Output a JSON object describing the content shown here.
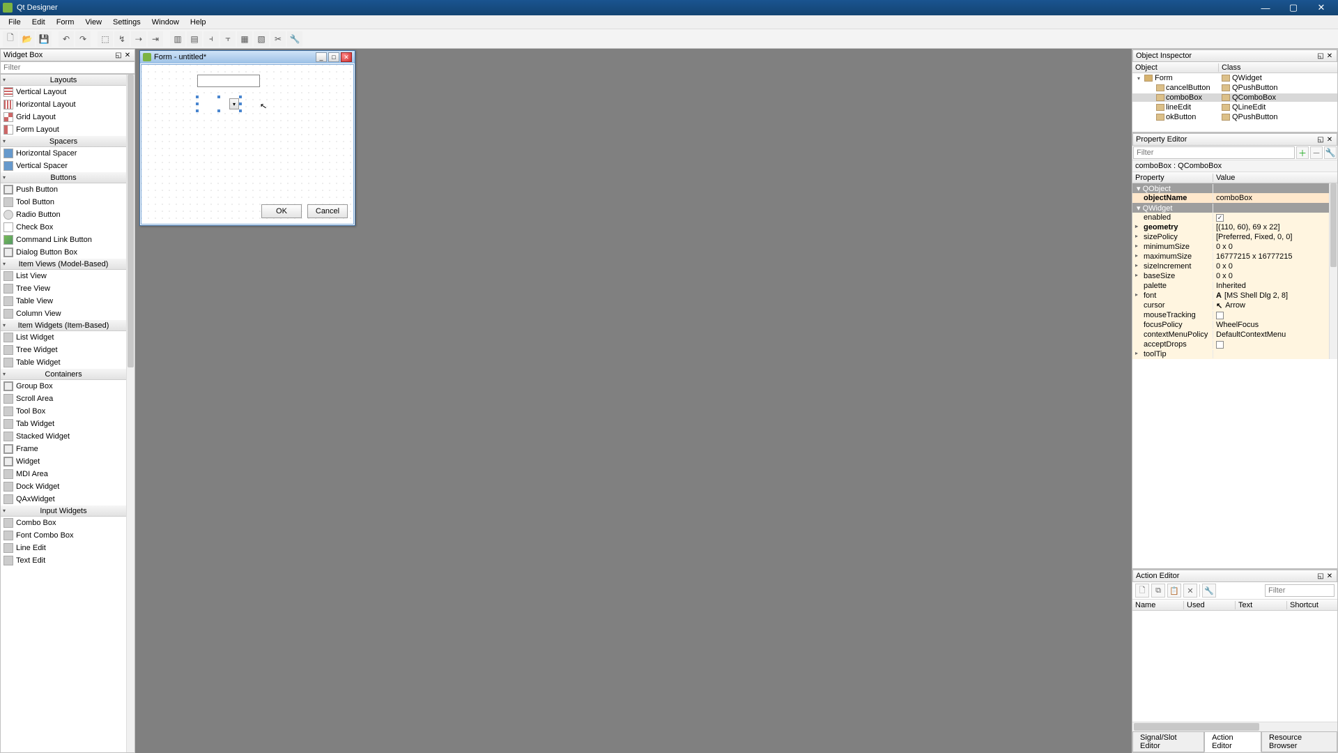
{
  "app": {
    "title": "Qt Designer"
  },
  "menu": [
    "File",
    "Edit",
    "Form",
    "View",
    "Settings",
    "Window",
    "Help"
  ],
  "widgetbox": {
    "title": "Widget Box",
    "filter_placeholder": "Filter",
    "groups": [
      {
        "name": "Layouts",
        "items": [
          {
            "cls": "vl",
            "label": "Vertical Layout"
          },
          {
            "cls": "hl",
            "label": "Horizontal Layout"
          },
          {
            "cls": "gl",
            "label": "Grid Layout"
          },
          {
            "cls": "fl",
            "label": "Form Layout"
          }
        ]
      },
      {
        "name": "Spacers",
        "items": [
          {
            "cls": "hs",
            "label": "Horizontal Spacer"
          },
          {
            "cls": "vs",
            "label": "Vertical Spacer"
          }
        ]
      },
      {
        "name": "Buttons",
        "items": [
          {
            "cls": "pb",
            "label": "Push Button"
          },
          {
            "cls": "tb",
            "label": "Tool Button"
          },
          {
            "cls": "rb",
            "label": "Radio Button"
          },
          {
            "cls": "cb",
            "label": "Check Box"
          },
          {
            "cls": "lk",
            "label": "Command Link Button"
          },
          {
            "cls": "pb",
            "label": "Dialog Button Box"
          }
        ]
      },
      {
        "name": "Item Views (Model-Based)",
        "items": [
          {
            "cls": "tb",
            "label": "List View"
          },
          {
            "cls": "tb",
            "label": "Tree View"
          },
          {
            "cls": "tb",
            "label": "Table View"
          },
          {
            "cls": "tb",
            "label": "Column View"
          }
        ]
      },
      {
        "name": "Item Widgets (Item-Based)",
        "items": [
          {
            "cls": "tb",
            "label": "List Widget"
          },
          {
            "cls": "tb",
            "label": "Tree Widget"
          },
          {
            "cls": "tb",
            "label": "Table Widget"
          }
        ]
      },
      {
        "name": "Containers",
        "items": [
          {
            "cls": "pb",
            "label": "Group Box"
          },
          {
            "cls": "tb",
            "label": "Scroll Area"
          },
          {
            "cls": "tb",
            "label": "Tool Box"
          },
          {
            "cls": "tb",
            "label": "Tab Widget"
          },
          {
            "cls": "tb",
            "label": "Stacked Widget"
          },
          {
            "cls": "pb",
            "label": "Frame"
          },
          {
            "cls": "pb",
            "label": "Widget"
          },
          {
            "cls": "tb",
            "label": "MDI Area"
          },
          {
            "cls": "tb",
            "label": "Dock Widget"
          },
          {
            "cls": "tb",
            "label": "QAxWidget"
          }
        ]
      },
      {
        "name": "Input Widgets",
        "items": [
          {
            "cls": "tb",
            "label": "Combo Box"
          },
          {
            "cls": "tb",
            "label": "Font Combo Box"
          },
          {
            "cls": "tb",
            "label": "Line Edit"
          },
          {
            "cls": "tb",
            "label": "Text Edit"
          }
        ]
      }
    ]
  },
  "form_window": {
    "title": "Form - untitled*",
    "ok": "OK",
    "cancel": "Cancel"
  },
  "object_inspector": {
    "title": "Object Inspector",
    "cols": [
      "Object",
      "Class"
    ],
    "rows": [
      {
        "indent": 0,
        "name": "Form",
        "cls": "QWidget",
        "exp": true
      },
      {
        "indent": 1,
        "name": "cancelButton",
        "cls": "QPushButton"
      },
      {
        "indent": 1,
        "name": "comboBox",
        "cls": "QComboBox",
        "sel": true
      },
      {
        "indent": 1,
        "name": "lineEdit",
        "cls": "QLineEdit"
      },
      {
        "indent": 1,
        "name": "okButton",
        "cls": "QPushButton"
      }
    ]
  },
  "property_editor": {
    "title": "Property Editor",
    "filter_placeholder": "Filter",
    "context": "comboBox : QComboBox",
    "cols": [
      "Property",
      "Value"
    ],
    "groups": [
      {
        "name": "QObject",
        "rows": [
          {
            "k": "objectName",
            "v": "comboBox",
            "cls": "obj"
          }
        ]
      },
      {
        "name": "QWidget",
        "rows": [
          {
            "k": "enabled",
            "v": "",
            "chk": true,
            "cls": "w"
          },
          {
            "k": "geometry",
            "v": "[(110, 60), 69 x 22]",
            "cls": "w",
            "exp": true
          },
          {
            "k": "sizePolicy",
            "v": "[Preferred, Fixed, 0, 0]",
            "cls": "w",
            "exp": true
          },
          {
            "k": "minimumSize",
            "v": "0 x 0",
            "cls": "w",
            "exp": true
          },
          {
            "k": "maximumSize",
            "v": "16777215 x 16777215",
            "cls": "w",
            "exp": true
          },
          {
            "k": "sizeIncrement",
            "v": "0 x 0",
            "cls": "w",
            "exp": true
          },
          {
            "k": "baseSize",
            "v": "0 x 0",
            "cls": "w",
            "exp": true
          },
          {
            "k": "palette",
            "v": "Inherited",
            "cls": "w"
          },
          {
            "k": "font",
            "v": "[MS Shell Dlg 2, 8]",
            "cls": "w",
            "exp": true,
            "icon": "A"
          },
          {
            "k": "cursor",
            "v": "Arrow",
            "cls": "w",
            "icon": "↖"
          },
          {
            "k": "mouseTracking",
            "v": "",
            "chk": false,
            "cls": "w"
          },
          {
            "k": "focusPolicy",
            "v": "WheelFocus",
            "cls": "w"
          },
          {
            "k": "contextMenuPolicy",
            "v": "DefaultContextMenu",
            "cls": "w"
          },
          {
            "k": "acceptDrops",
            "v": "",
            "chk": false,
            "cls": "w"
          },
          {
            "k": "toolTip",
            "v": "",
            "cls": "w",
            "exp": true
          }
        ]
      }
    ]
  },
  "action_editor": {
    "title": "Action Editor",
    "filter_placeholder": "Filter",
    "cols": [
      "Name",
      "Used",
      "Text",
      "Shortcut"
    ]
  },
  "bottom_tabs": [
    "Signal/Slot Editor",
    "Action Editor",
    "Resource Browser"
  ],
  "active_tab": 1
}
